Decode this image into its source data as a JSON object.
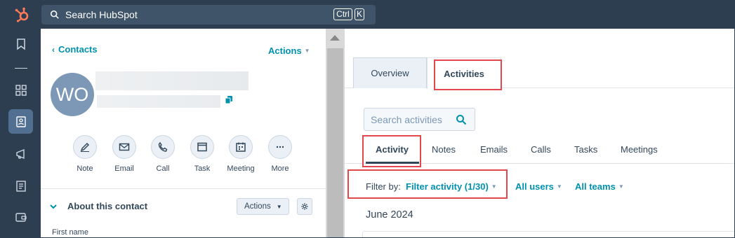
{
  "topbar": {
    "search_placeholder": "Search HubSpot",
    "shortcut_ctrl": "Ctrl",
    "shortcut_key": "K"
  },
  "left_panel": {
    "back_label": "Contacts",
    "actions_label": "Actions",
    "avatar_initials": "WO",
    "quick_actions": [
      {
        "label": "Note",
        "icon": "pencil-icon"
      },
      {
        "label": "Email",
        "icon": "envelope-icon"
      },
      {
        "label": "Call",
        "icon": "phone-icon"
      },
      {
        "label": "Task",
        "icon": "task-icon"
      },
      {
        "label": "Meeting",
        "icon": "calendar-icon"
      },
      {
        "label": "More",
        "icon": "ellipsis-icon"
      }
    ],
    "about_title": "About this contact",
    "about_actions_label": "Actions",
    "first_field_label": "First name"
  },
  "right_panel": {
    "tabs": [
      {
        "label": "Overview",
        "selected": false
      },
      {
        "label": "Activities",
        "selected": true
      }
    ],
    "search_placeholder": "Search activities",
    "sub_tabs": [
      {
        "label": "Activity",
        "selected": true
      },
      {
        "label": "Notes",
        "selected": false
      },
      {
        "label": "Emails",
        "selected": false
      },
      {
        "label": "Calls",
        "selected": false
      },
      {
        "label": "Tasks",
        "selected": false
      },
      {
        "label": "Meetings",
        "selected": false
      }
    ],
    "filter_label": "Filter by:",
    "filter_value": "Filter activity (1/30)",
    "users_filter": "All users",
    "teams_filter": "All teams",
    "month_header": "June 2024"
  },
  "colors": {
    "nav_bg": "#2d3e50",
    "link": "#0091ae",
    "highlight": "#e2474b",
    "avatar": "#7c98b6"
  }
}
